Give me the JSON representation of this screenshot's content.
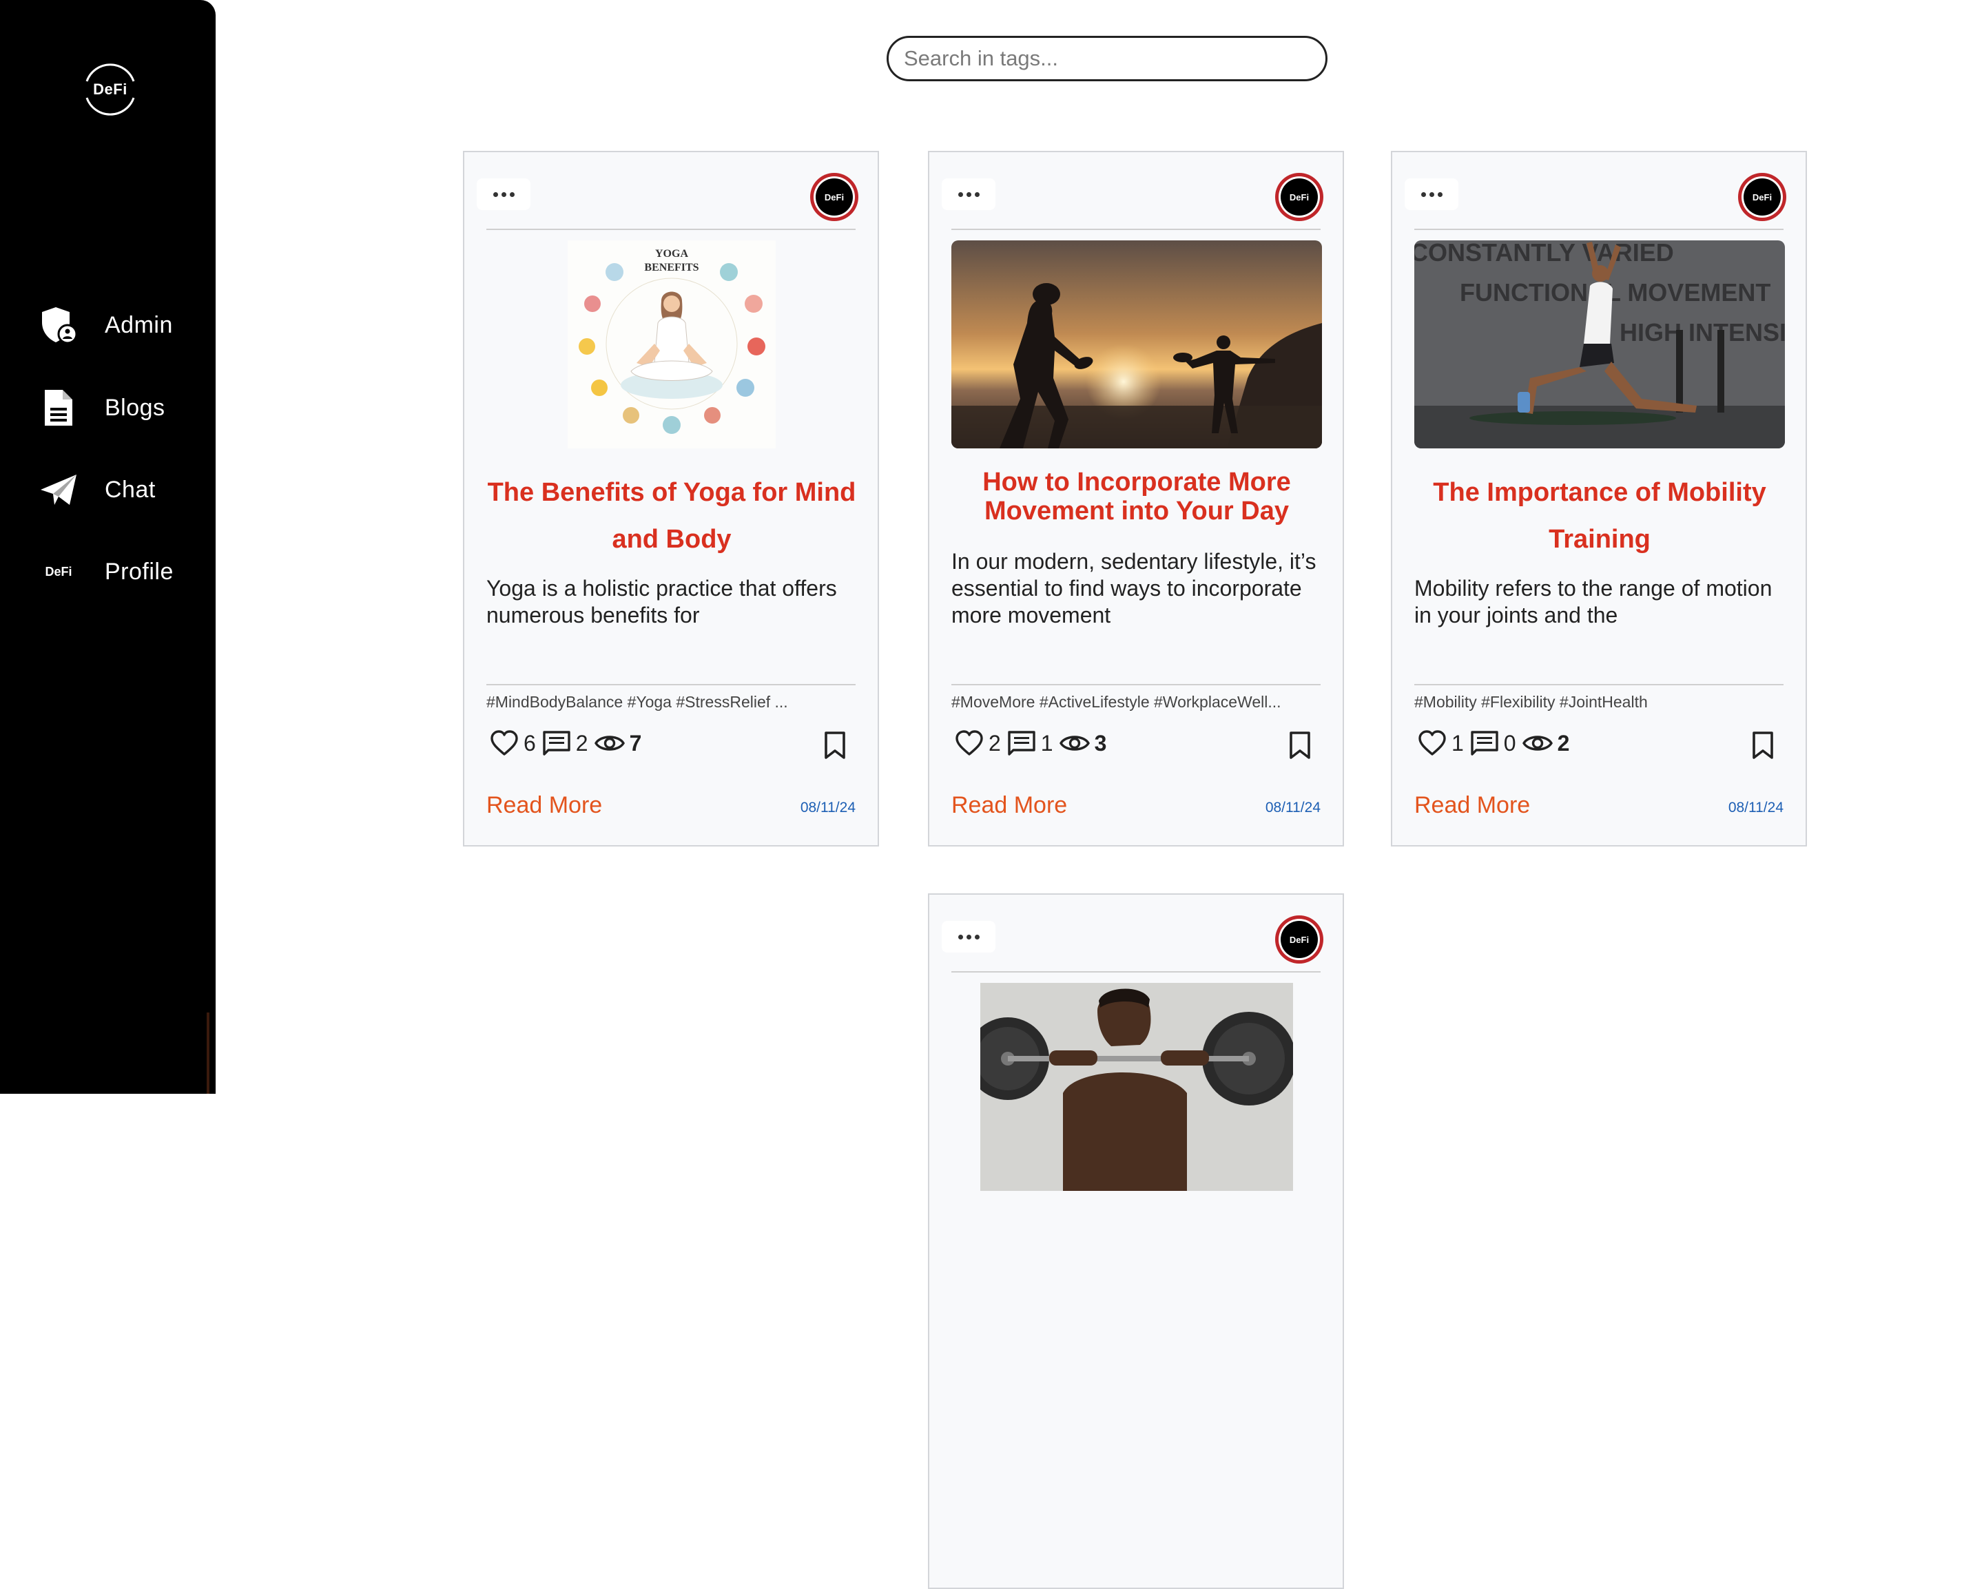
{
  "sidebar": {
    "brand": "DeFi",
    "items": [
      {
        "label": "Admin",
        "icon": "admin-shield-icon"
      },
      {
        "label": "Blogs",
        "icon": "document-icon"
      },
      {
        "label": "Chat",
        "icon": "paper-plane-icon"
      },
      {
        "label": "Profile",
        "icon": "defi-mini-logo"
      }
    ],
    "profile_mini_brand": "DeFi"
  },
  "search": {
    "placeholder": "Search in tags..."
  },
  "avatar_label": "DeFi",
  "colors": {
    "title": "#d9301f",
    "read_more": "#e3541d",
    "date": "#1d5fb4",
    "avatar_ring": "#c0262a",
    "sidebar": "#000000"
  },
  "cards": [
    {
      "title": "The Benefits of Yoga for Mind and Body",
      "excerpt": "Yoga is a holistic practice that offers numerous benefits for",
      "image": "yoga-benefits-illustration",
      "image_text": {
        "heading1": "YOGA",
        "heading2": "BENEFITS"
      },
      "tags": "#MindBodyBalance #Yoga #StressRelief ...",
      "likes": "6",
      "comments": "2",
      "views": "7",
      "read_more": "Read More",
      "date": "08/11/24"
    },
    {
      "title": "How to Incorporate More Movement into Your Day",
      "excerpt": "In our modern, sedentary lifestyle, it’s essential to find ways to incorporate more movement",
      "image": "beach-paddle-ball-sunset-photo",
      "tags": "#MoveMore #ActiveLifestyle #WorkplaceWell...",
      "likes": "2",
      "comments": "1",
      "views": "3",
      "read_more": "Read More",
      "date": "08/11/24"
    },
    {
      "title": "The Importance of Mobility Training",
      "excerpt": "Mobility refers to the range of motion in your joints and the",
      "image": "gym-lunge-stretch-photo",
      "image_text": {
        "line1": "CONSTANTLY VARIED",
        "line2": "FUNCTIONAL MOVEMENT",
        "line3": "HIGH INTENSITY"
      },
      "tags": "#Mobility #Flexibility #JointHealth",
      "likes": "1",
      "comments": "0",
      "views": "2",
      "read_more": "Read More",
      "date": "08/11/24"
    },
    {
      "image": "weightlifter-barbell-photo"
    }
  ]
}
